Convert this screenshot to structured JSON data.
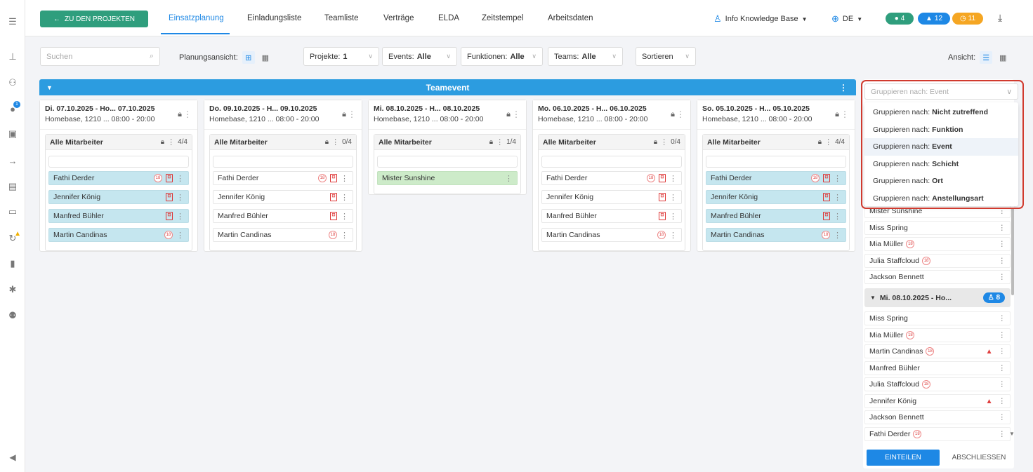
{
  "sidebar": {
    "icons": [
      "menu-icon",
      "org-chart-icon",
      "users-icon",
      "user-notification-icon",
      "calendar-icon",
      "login-icon",
      "building-icon",
      "cash-icon",
      "sync-warning-icon",
      "document-icon",
      "settings-icon",
      "user-admin-icon"
    ],
    "notification_count": "1",
    "footer_icon": "megaphone-icon"
  },
  "header": {
    "back_label": "ZU DEN PROJEKTEN",
    "tabs": [
      "Einsatzplanung",
      "Einladungsliste",
      "Teamliste",
      "Verträge",
      "ELDA",
      "Zeitstempel",
      "Arbeitsdaten"
    ],
    "active_tab": "Einsatzplanung",
    "knowledge_base": "Info Knowledge Base",
    "language": "DE",
    "badges": [
      {
        "icon": "chat",
        "count": "4",
        "color": "#2f9e7d"
      },
      {
        "icon": "bell",
        "count": "12",
        "color": "#1e88e5"
      },
      {
        "icon": "clock",
        "count": "11",
        "color": "#f5a623"
      }
    ]
  },
  "toolbar": {
    "search_placeholder": "Suchen",
    "view_label": "Planungsansicht:",
    "filters": [
      {
        "label": "Projekte:",
        "value": "1"
      },
      {
        "label": "Events:",
        "value": "Alle"
      },
      {
        "label": "Funktionen:",
        "value": "Alle"
      },
      {
        "label": "Teams:",
        "value": "Alle"
      }
    ],
    "sort_label": "Sortieren",
    "ansicht_label": "Ansicht:"
  },
  "banner": {
    "title": "Teamevent"
  },
  "columns": [
    {
      "line1": "Di. 07.10.2025 - Ho...  07.10.2025",
      "line2": "Homebase, 1210 ...   08:00 - 20:00",
      "group": "Alle Mitarbeiter",
      "count": "4/4",
      "employees": [
        {
          "name": "Fathi Derder",
          "style": "blue",
          "b18": true,
          "pdf": true
        },
        {
          "name": "Jennifer König",
          "style": "blue",
          "b18": false,
          "pdf": true
        },
        {
          "name": "Manfred Bühler",
          "style": "blue",
          "b18": false,
          "pdf": true
        },
        {
          "name": "Martin Candinas",
          "style": "blue",
          "b18": true,
          "pdf": false
        }
      ]
    },
    {
      "line1": "Do. 09.10.2025 - H...  09.10.2025",
      "line2": "Homebase, 1210 ...   08:00 - 20:00",
      "group": "Alle Mitarbeiter",
      "count": "0/4",
      "employees": [
        {
          "name": "Fathi Derder",
          "style": "white",
          "b18": true,
          "pdf": true
        },
        {
          "name": "Jennifer König",
          "style": "white",
          "b18": false,
          "pdf": true
        },
        {
          "name": "Manfred Bühler",
          "style": "white",
          "b18": false,
          "pdf": true
        },
        {
          "name": "Martin Candinas",
          "style": "white",
          "b18": true,
          "pdf": false
        }
      ]
    },
    {
      "line1": "Mi. 08.10.2025 - H...  08.10.2025",
      "line2": "Homebase, 1210 ...   08:00 - 20:00",
      "group": "Alle Mitarbeiter",
      "count": "1/4",
      "employees": [
        {
          "name": "Mister Sunshine",
          "style": "green",
          "b18": false,
          "pdf": false
        }
      ]
    },
    {
      "line1": "Mo. 06.10.2025 - H...  06.10.2025",
      "line2": "Homebase, 1210 ...   08:00 - 20:00",
      "group": "Alle Mitarbeiter",
      "count": "0/4",
      "employees": [
        {
          "name": "Fathi Derder",
          "style": "white",
          "b18": true,
          "pdf": true
        },
        {
          "name": "Jennifer König",
          "style": "white",
          "b18": false,
          "pdf": true
        },
        {
          "name": "Manfred Bühler",
          "style": "white",
          "b18": false,
          "pdf": true
        },
        {
          "name": "Martin Candinas",
          "style": "white",
          "b18": true,
          "pdf": false
        }
      ]
    },
    {
      "line1": "So. 05.10.2025 - H...  05.10.2025",
      "line2": "Homebase, 1210 ...   08:00 - 20:00",
      "group": "Alle Mitarbeiter",
      "count": "4/4",
      "employees": [
        {
          "name": "Fathi Derder",
          "style": "blue",
          "b18": true,
          "pdf": true
        },
        {
          "name": "Jennifer König",
          "style": "blue",
          "b18": false,
          "pdf": true
        },
        {
          "name": "Manfred Bühler",
          "style": "blue",
          "b18": false,
          "pdf": true
        },
        {
          "name": "Martin Candinas",
          "style": "blue",
          "b18": true,
          "pdf": false
        }
      ]
    }
  ],
  "right_panel": {
    "group_select_placeholder": "Gruppieren nach: Event",
    "group_options": [
      {
        "prefix": "Gruppieren nach:",
        "value": "Nicht zutreffend"
      },
      {
        "prefix": "Gruppieren nach:",
        "value": "Funktion"
      },
      {
        "prefix": "Gruppieren nach:",
        "value": "Event"
      },
      {
        "prefix": "Gruppieren nach:",
        "value": "Schicht"
      },
      {
        "prefix": "Gruppieren nach:",
        "value": "Ort"
      },
      {
        "prefix": "Gruppieren nach:",
        "value": "Anstellungsart"
      }
    ],
    "selected_option": "Event",
    "list_top": [
      {
        "name": "Mister Sunshine",
        "b18": false,
        "warn": false
      },
      {
        "name": "Miss Spring",
        "b18": false,
        "warn": false
      },
      {
        "name": "Mia Müller",
        "b18": true,
        "warn": false
      },
      {
        "name": "Julia Staffcloud",
        "b18": true,
        "warn": false
      },
      {
        "name": "Jackson Bennett",
        "b18": false,
        "warn": false
      }
    ],
    "group_title": "Mi. 08.10.2025 - Ho...",
    "group_count": "8",
    "list_group": [
      {
        "name": "Miss Spring",
        "b18": false,
        "warn": false
      },
      {
        "name": "Mia Müller",
        "b18": true,
        "warn": false
      },
      {
        "name": "Martin Candinas",
        "b18": true,
        "warn": true
      },
      {
        "name": "Manfred Bühler",
        "b18": false,
        "warn": false
      },
      {
        "name": "Julia Staffcloud",
        "b18": true,
        "warn": false
      },
      {
        "name": "Jennifer König",
        "b18": false,
        "warn": true
      },
      {
        "name": "Jackson Bennett",
        "b18": false,
        "warn": false
      },
      {
        "name": "Fathi Derder",
        "b18": true,
        "warn": false
      }
    ],
    "assign_label": "EINTEILEN",
    "close_label": "ABSCHLIESSEN"
  }
}
